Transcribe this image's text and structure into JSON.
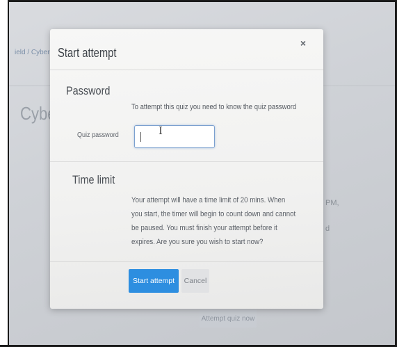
{
  "background": {
    "breadcrumb": "ield / Cyber",
    "page_heading": "Cyber S",
    "side_text_pm": "PM,",
    "side_text_d": "d",
    "attempt_quiz_button": "Attempt quiz now"
  },
  "modal": {
    "title": "Start attempt",
    "close_label": "×",
    "password_section": {
      "heading": "Password",
      "help_text": "To attempt this quiz you need to know the quiz password",
      "field_label": "Quiz password",
      "field_value": ""
    },
    "time_limit_section": {
      "heading": "Time limit",
      "text": "Your attempt will have a time limit of 20 mins. When you start, the timer will begin to count down and cannot be paused. You must finish your attempt before it expires. Are you sure you wish to start now?"
    },
    "buttons": {
      "start": "Start attempt",
      "cancel": "Cancel"
    }
  },
  "colors": {
    "primary_button": "#2d8ee0",
    "input_focus_border": "#7ba0cf"
  }
}
